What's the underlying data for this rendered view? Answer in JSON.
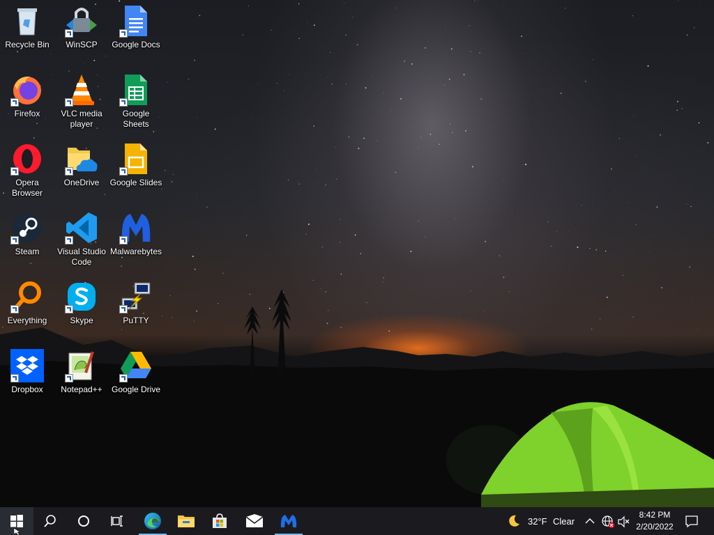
{
  "desktop": {
    "icons": [
      {
        "label": "Recycle Bin",
        "icon": "recycle-bin-icon"
      },
      {
        "label": "WinSCP",
        "icon": "winscp-icon"
      },
      {
        "label": "Google Docs",
        "icon": "google-docs-icon"
      },
      {
        "label": "Firefox",
        "icon": "firefox-icon"
      },
      {
        "label": "VLC media player",
        "icon": "vlc-icon"
      },
      {
        "label": "Google Sheets",
        "icon": "google-sheets-icon"
      },
      {
        "label": "Opera Browser",
        "icon": "opera-icon"
      },
      {
        "label": "OneDrive",
        "icon": "onedrive-icon"
      },
      {
        "label": "Google Slides",
        "icon": "google-slides-icon"
      },
      {
        "label": "Steam",
        "icon": "steam-icon"
      },
      {
        "label": "Visual Studio Code",
        "icon": "vscode-icon"
      },
      {
        "label": "Malwarebytes",
        "icon": "malwarebytes-icon"
      },
      {
        "label": "Everything",
        "icon": "everything-icon"
      },
      {
        "label": "Skype",
        "icon": "skype-icon"
      },
      {
        "label": "PuTTY",
        "icon": "putty-icon"
      },
      {
        "label": "Dropbox",
        "icon": "dropbox-icon"
      },
      {
        "label": "Notepad++",
        "icon": "notepadpp-icon"
      },
      {
        "label": "Google Drive",
        "icon": "google-drive-icon"
      }
    ]
  },
  "taskbar": {
    "pinned": [
      "start-icon",
      "search-icon",
      "cortana-icon",
      "task-view-icon",
      "edge-icon",
      "file-explorer-icon",
      "store-icon",
      "mail-icon",
      "malwarebytes-icon"
    ],
    "weather": {
      "temp": "32°F",
      "condition": "Clear",
      "icon": "moon-icon"
    },
    "tray": [
      "chevron-up-icon",
      "network-icon",
      "volume-muted-icon",
      "notification-icon"
    ],
    "clock": {
      "time": "8:42 PM",
      "date": "2/20/2022"
    },
    "accent": "#76b9ed"
  }
}
